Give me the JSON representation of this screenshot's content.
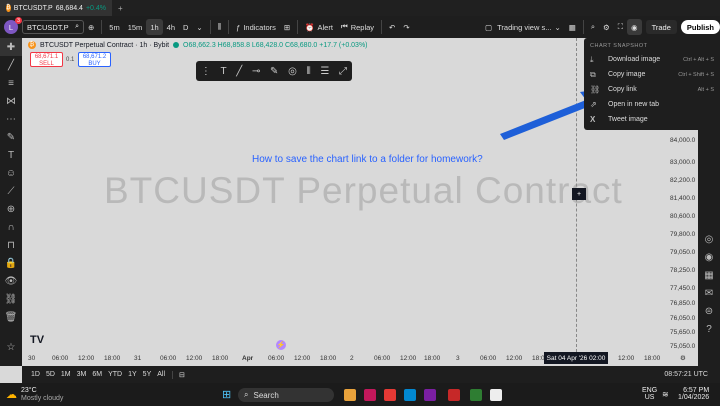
{
  "browser": {
    "tab_title": "BTCUSDT.P",
    "tab_price": "68,684.4",
    "tab_change": "+0.4%",
    "new_tab": "+"
  },
  "toolbar": {
    "avatar": "L",
    "avatar_badge": "3",
    "symbol": "BTCUSDT.P",
    "intervals": [
      "5m",
      "15m",
      "1h",
      "4h",
      "D"
    ],
    "active_interval": "1h",
    "indicators": "Indicators",
    "alert": "Alert",
    "replay": "Replay",
    "layout": "Trading view s...",
    "trade": "Trade",
    "publish": "Publish"
  },
  "legend": {
    "title": "BTCUSDT Perpetual Contract · 1h · Bybit",
    "ohlc": "O68,662.3 H68,858.8 L68,428.0 C68,680.0 +17.7 (+0.03%)"
  },
  "order": {
    "sell_price": "68,671.1",
    "sell_label": "SELL",
    "spread": "0.1",
    "buy_price": "68,671.2",
    "buy_label": "BUY"
  },
  "watermark": "BTCUSDT Perpetual Contract",
  "question": "How to save the chart link to a folder for homework?",
  "price_axis": [
    "84,000.0",
    "83,000.0",
    "82,200.0",
    "81,400.0",
    "80,600.0",
    "79,800.0",
    "79,050.0",
    "78,250.0",
    "77,450.0",
    "76,850.0",
    "76,050.0",
    "75,650.0",
    "75,050.0"
  ],
  "time_axis": [
    "30",
    "06:00",
    "12:00",
    "18:00",
    "31",
    "06:00",
    "12:00",
    "18:00",
    "Apr",
    "06:00",
    "12:00",
    "18:00",
    "2",
    "06:00",
    "12:00",
    "18:00",
    "3",
    "06:00",
    "12:00",
    "18:00",
    "06:00",
    "12:00",
    "18:00"
  ],
  "crosshair": {
    "time": "Sat 04 Apr '26   02:00"
  },
  "menu": {
    "heading": "CHART SNAPSHOT",
    "items": [
      {
        "label": "Download image",
        "shortcut": "Ctrl + Alt + S",
        "icon": "download-icon"
      },
      {
        "label": "Copy image",
        "shortcut": "Ctrl + Shift + S",
        "icon": "copy-icon"
      },
      {
        "label": "Copy link",
        "shortcut": "Alt + S",
        "icon": "link-icon"
      },
      {
        "label": "Open in new tab",
        "shortcut": "",
        "icon": "external-icon"
      },
      {
        "label": "Tweet image",
        "shortcut": "",
        "icon": "x-icon"
      }
    ]
  },
  "bottom": {
    "ranges": [
      "1D",
      "5D",
      "1M",
      "3M",
      "6M",
      "YTD",
      "1Y",
      "5Y",
      "All"
    ],
    "clock": "08:57:21 UTC"
  },
  "taskbar": {
    "temp": "23°C",
    "weather": "Mostly cloudy",
    "search": "Search",
    "lang": "ENG",
    "region": "US",
    "time": "6:57 PM",
    "date": "1/04/2026"
  },
  "colors": {
    "accent": "#2962ff",
    "sell": "#f23645",
    "buy": "#2962ff",
    "bitcoin": "#f7931a"
  }
}
